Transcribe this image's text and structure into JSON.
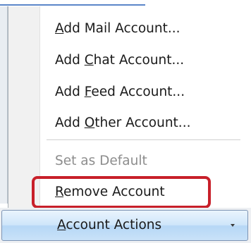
{
  "menu": {
    "items": [
      {
        "pre": "",
        "key": "A",
        "post": "dd Mail Account...",
        "enabled": true
      },
      {
        "pre": "Add ",
        "key": "C",
        "post": "hat Account...",
        "enabled": true
      },
      {
        "pre": "Add ",
        "key": "F",
        "post": "eed Account...",
        "enabled": true
      },
      {
        "pre": "Add ",
        "key": "O",
        "post": "ther Account...",
        "enabled": true
      },
      {
        "pre": "",
        "key": "",
        "post": "Set as Default",
        "enabled": false
      },
      {
        "pre": "",
        "key": "R",
        "post": "emove Account",
        "enabled": true
      }
    ],
    "highlight_color": "#c8202a"
  },
  "account_actions": {
    "pre": "",
    "key": "A",
    "post": "ccount Actions"
  }
}
